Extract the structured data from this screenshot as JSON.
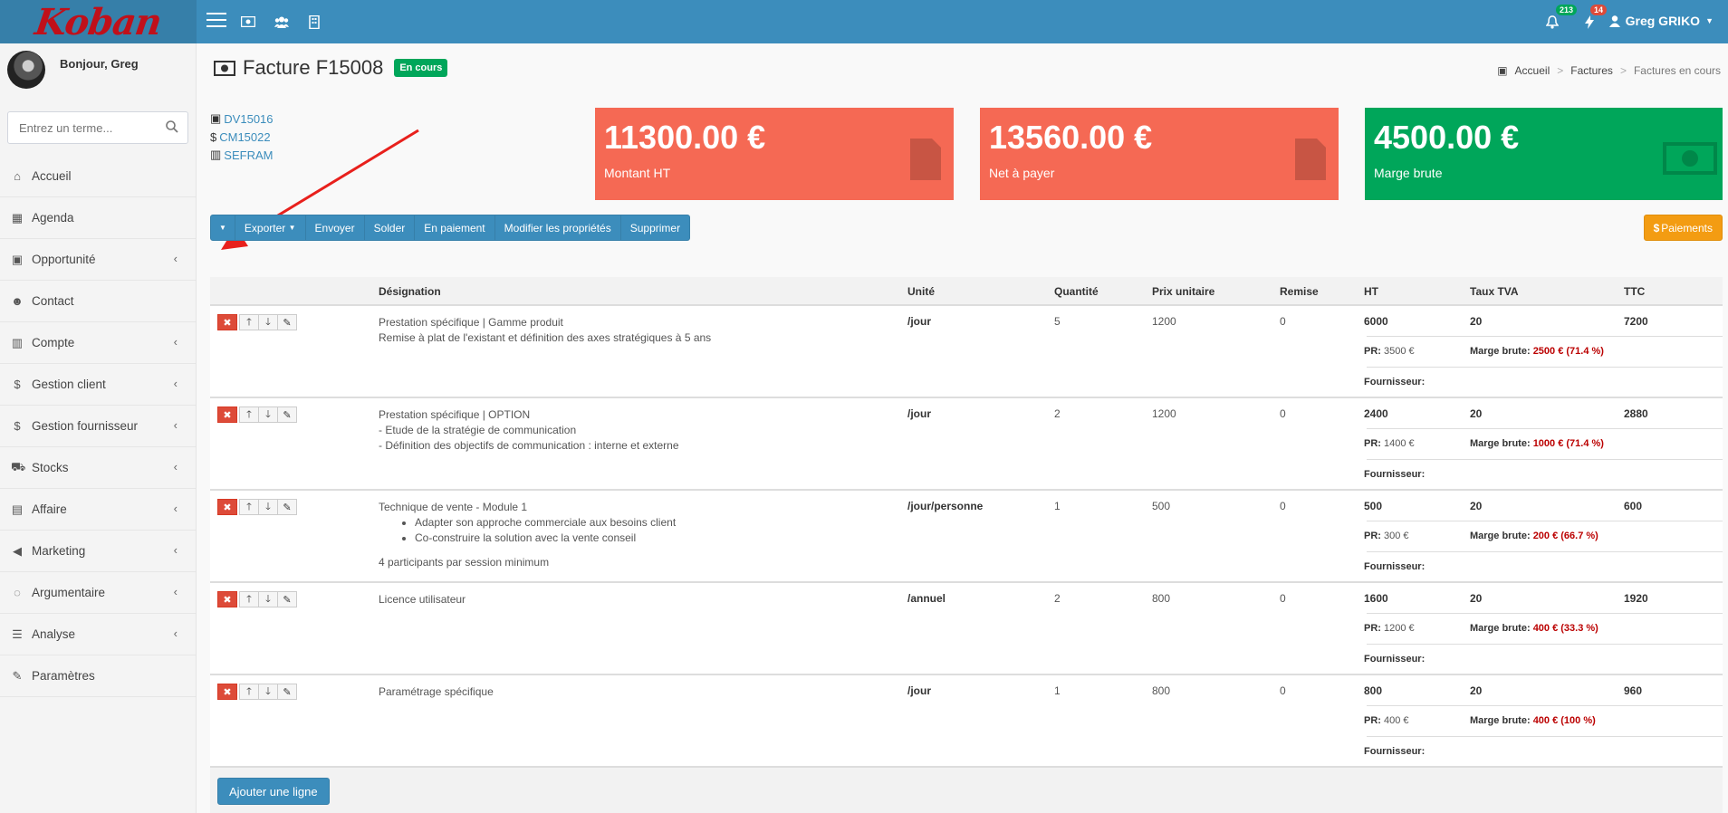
{
  "app": {
    "logo_text": "Koban"
  },
  "topnav": {
    "notif_count": "213",
    "flash_count": "14",
    "user_name": "Greg GRIKO"
  },
  "sidebar": {
    "greeting": "Bonjour, Greg",
    "search_placeholder": "Entrez un terme...",
    "items": [
      {
        "label": "Accueil",
        "icon": "home-icon"
      },
      {
        "label": "Agenda",
        "icon": "calendar-icon"
      },
      {
        "label": "Opportunité",
        "icon": "money-icon"
      },
      {
        "label": "Contact",
        "icon": "users-icon"
      },
      {
        "label": "Compte",
        "icon": "building-icon"
      },
      {
        "label": "Gestion client",
        "icon": "dollar-icon"
      },
      {
        "label": "Gestion fournisseur",
        "icon": "dollar-icon"
      },
      {
        "label": "Stocks",
        "icon": "truck-icon"
      },
      {
        "label": "Affaire",
        "icon": "briefcase-icon"
      },
      {
        "label": "Marketing",
        "icon": "bullhorn-icon"
      },
      {
        "label": "Argumentaire",
        "icon": "comments-icon"
      },
      {
        "label": "Analyse",
        "icon": "tasks-icon"
      },
      {
        "label": "Paramètres",
        "icon": "wrench-icon"
      }
    ]
  },
  "page": {
    "title": "Facture F15008",
    "status": "En cours",
    "breadcrumb": [
      "Accueil",
      "Factures",
      "Factures en cours"
    ],
    "links": [
      "DV15016",
      "CM15022",
      "SEFRAM"
    ]
  },
  "kpis": [
    {
      "value": "11300.00 €",
      "label": "Montant HT",
      "color": "#f56954"
    },
    {
      "value": "13560.00 €",
      "label": "Net à payer",
      "color": "#f56954"
    },
    {
      "value": "4500.00 €",
      "label": "Marge brute",
      "color": "#00a65a"
    }
  ],
  "actions": {
    "export": "Exporter",
    "send": "Envoyer",
    "settle": "Solder",
    "in_payment": "En paiement",
    "edit_props": "Modifier les propriétés",
    "delete": "Supprimer",
    "payments": "Paiements"
  },
  "table": {
    "headers": {
      "designation": "Désignation",
      "unit": "Unité",
      "qty": "Quantité",
      "unit_price": "Prix unitaire",
      "discount": "Remise",
      "ht": "HT",
      "vat": "Taux TVA",
      "ttc": "TTC"
    },
    "labels": {
      "pr": "PR:",
      "margin": "Marge brute:",
      "supplier": "Fournisseur:"
    },
    "rows": [
      {
        "title": "Prestation spécifique | Gamme produit",
        "lines": [
          "Remise à plat de l'existant et définition des axes stratégiques à 5 ans"
        ],
        "bullets": [],
        "note": "",
        "unit": "/jour",
        "qty": "5",
        "price": "1200",
        "discount": "0",
        "ht": "6000",
        "vat": "20",
        "ttc": "7200",
        "pr": "3500 €",
        "margin": "2500 € (71.4 %)"
      },
      {
        "title": "Prestation spécifique | OPTION",
        "lines": [
          "- Etude de la stratégie de communication",
          "- Définition des objectifs de communication : interne et externe"
        ],
        "bullets": [],
        "note": "",
        "unit": "/jour",
        "qty": "2",
        "price": "1200",
        "discount": "0",
        "ht": "2400",
        "vat": "20",
        "ttc": "2880",
        "pr": "1400 €",
        "margin": "1000 € (71.4 %)"
      },
      {
        "title": "Technique de vente - Module 1",
        "lines": [],
        "bullets": [
          "Adapter son approche commerciale aux besoins client",
          "Co-construire la solution avec la vente conseil"
        ],
        "note": "4 participants par session minimum",
        "unit": "/jour/personne",
        "qty": "1",
        "price": "500",
        "discount": "0",
        "ht": "500",
        "vat": "20",
        "ttc": "600",
        "pr": "300 €",
        "margin": "200 € (66.7 %)"
      },
      {
        "title": "Licence utilisateur",
        "lines": [],
        "bullets": [],
        "note": "",
        "unit": "/annuel",
        "qty": "2",
        "price": "800",
        "discount": "0",
        "ht": "1600",
        "vat": "20",
        "ttc": "1920",
        "pr": "1200 €",
        "margin": "400 € (33.3 %)"
      },
      {
        "title": "Paramétrage spécifique",
        "lines": [],
        "bullets": [],
        "note": "",
        "unit": "/jour",
        "qty": "1",
        "price": "800",
        "discount": "0",
        "ht": "800",
        "vat": "20",
        "ttc": "960",
        "pr": "400 €",
        "margin": "400 € (100 %)"
      }
    ],
    "add_line": "Ajouter une ligne"
  }
}
